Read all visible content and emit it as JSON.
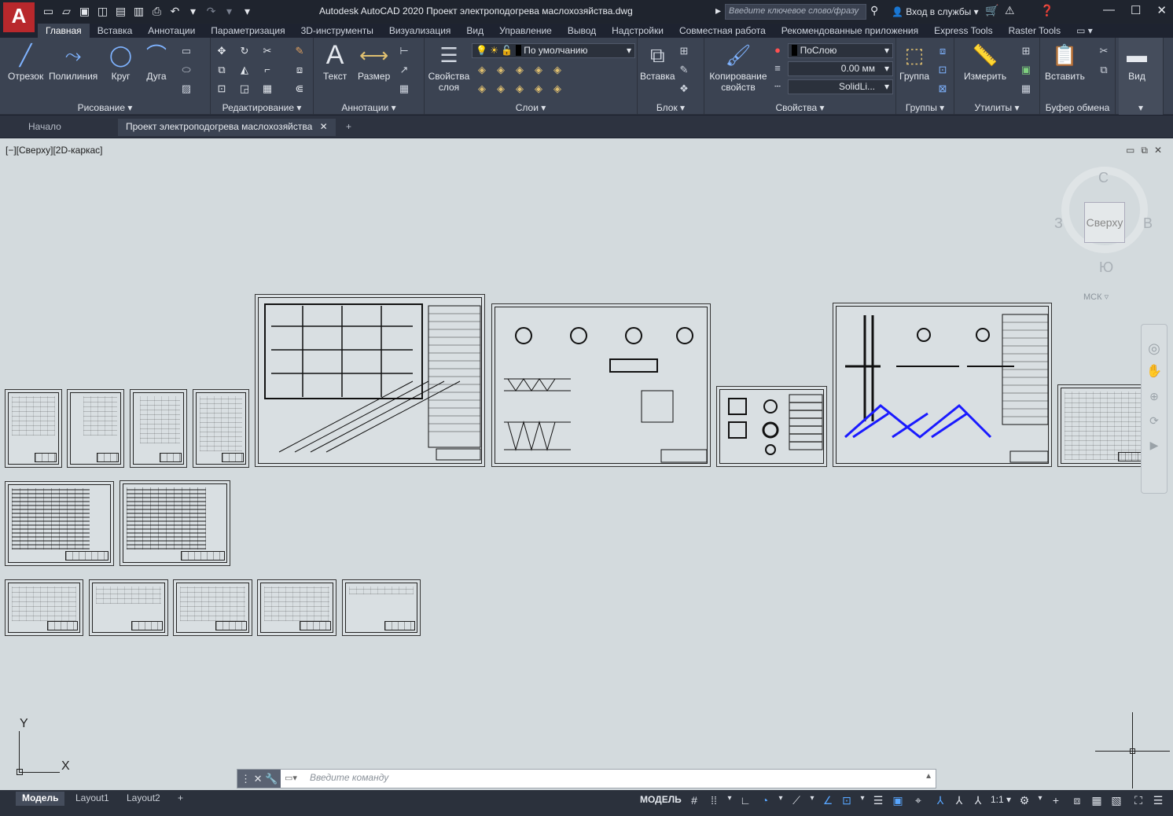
{
  "titlebar": {
    "app_logo": "A",
    "title": "Autodesk AutoCAD 2020   Проект электроподогрева маслохозяйства.dwg",
    "search_placeholder": "Введите ключевое слово/фразу",
    "signin": "Вход в службы",
    "quick_access_icons": [
      "new-icon",
      "open-icon",
      "save-icon",
      "save-as-icon",
      "web-icon",
      "plot-icon",
      "undo-icon",
      "redo-icon"
    ]
  },
  "ribbon_tabs": [
    "Главная",
    "Вставка",
    "Аннотации",
    "Параметризация",
    "3D-инструменты",
    "Визуализация",
    "Вид",
    "Управление",
    "Вывод",
    "Надстройки",
    "Совместная работа",
    "Рекомендованные приложения",
    "Express Tools",
    "Raster Tools"
  ],
  "ribbon": {
    "draw": {
      "label": "Рисование",
      "line": "Отрезок",
      "polyline": "Полилиния",
      "circle": "Круг",
      "arc": "Дуга"
    },
    "modify": {
      "label": "Редактирование"
    },
    "annotation": {
      "label": "Аннотации",
      "text": "Текст",
      "dimension": "Размер"
    },
    "layers": {
      "label": "Слои",
      "layer_props": "Свойства слоя",
      "current_layer": "По умолчанию"
    },
    "block": {
      "label": "Блок",
      "insert": "Вставка"
    },
    "properties": {
      "label": "Свойства",
      "match": "Копирование свойств",
      "color": "ПоСлою",
      "lineweight": "0.00 мм",
      "linetype": "SolidLi..."
    },
    "groups": {
      "label": "Группы",
      "group": "Группа"
    },
    "utilities": {
      "label": "Утилиты",
      "measure": "Измерить"
    },
    "clipboard": {
      "label": "Буфер обмена",
      "paste": "Вставить"
    },
    "view": {
      "label": "Вид"
    }
  },
  "doc_tabs": {
    "start": "Начало",
    "current": "Проект электроподогрева маслохозяйства",
    "close": "✕",
    "add": "+"
  },
  "viewport": {
    "label": "[−][Сверху][2D-каркас]",
    "viewcube": {
      "top": "Сверху",
      "north": "С",
      "south": "Ю",
      "west": "З",
      "east": "В",
      "ucs": "МСК"
    },
    "ucs_icon": {
      "x": "X",
      "y": "Y"
    }
  },
  "command": {
    "placeholder": "Введите команду"
  },
  "statusbar": {
    "layouts": [
      "Модель",
      "Layout1",
      "Layout2"
    ],
    "add": "+",
    "model": "МОДЕЛЬ",
    "scale": "1:1"
  },
  "colors": {
    "accent": "#58a6ff",
    "ribbon": "#3b4352",
    "viewport": "#d3dadd",
    "logo": "#b8282c",
    "blue_drawing": "#1a1aff"
  }
}
